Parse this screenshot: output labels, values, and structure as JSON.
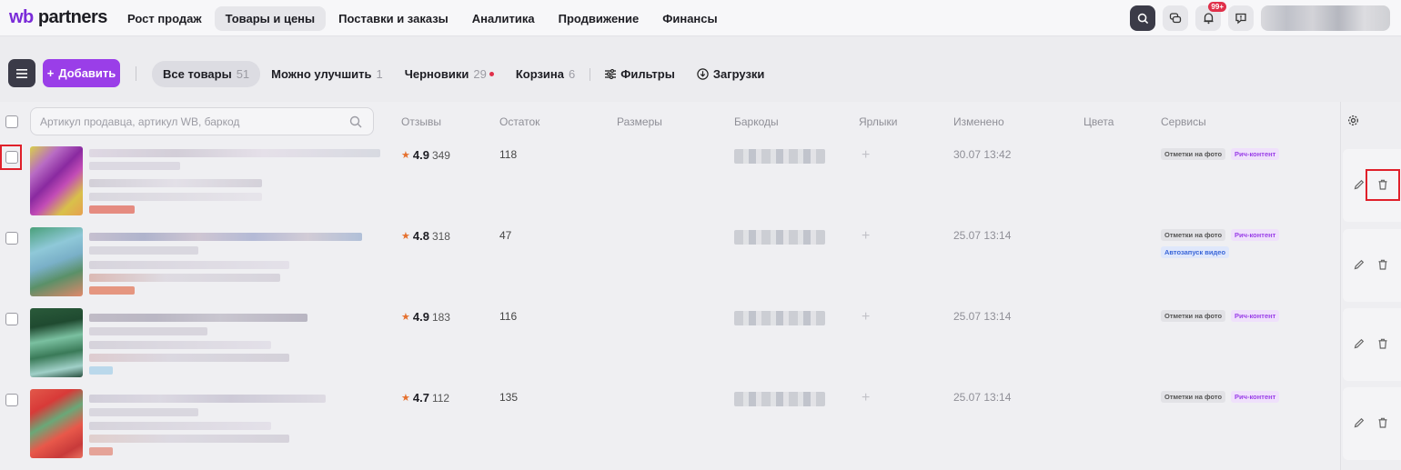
{
  "brand": {
    "logo_prefix": "wb",
    "logo_suffix": " partners"
  },
  "nav": {
    "items": [
      {
        "label": "Рост продаж",
        "active": false
      },
      {
        "label": "Товары и цены",
        "active": true
      },
      {
        "label": "Поставки и заказы",
        "active": false
      },
      {
        "label": "Аналитика",
        "active": false
      },
      {
        "label": "Продвижение",
        "active": false
      },
      {
        "label": "Финансы",
        "active": false
      }
    ],
    "notifications_badge": "99+",
    "icons": [
      "search-icon",
      "chat-icon",
      "bell-icon",
      "support-icon"
    ]
  },
  "toolbar": {
    "add_label": "Добавить",
    "tabs": [
      {
        "label": "Все товары",
        "count": "51",
        "active": true
      },
      {
        "label": "Можно улучшить",
        "count": "1"
      },
      {
        "label": "Черновики",
        "count": "29"
      },
      {
        "label": "Корзина",
        "count": "6"
      }
    ],
    "filters_label": "Фильтры",
    "uploads_label": "Загрузки"
  },
  "table": {
    "search_placeholder": "Артикул продавца, артикул WB, баркод",
    "columns": {
      "reviews": "Отзывы",
      "stock": "Остаток",
      "sizes": "Размеры",
      "barcodes": "Баркоды",
      "labels": "Ярлыки",
      "changed": "Изменено",
      "colors": "Цвета",
      "services": "Сервисы"
    },
    "rows": [
      {
        "rating": "4.9",
        "reviews": "349",
        "stock": "118",
        "changed": "30.07 13:42",
        "services": [
          "Отметки на фото",
          "Рич-контент"
        ]
      },
      {
        "rating": "4.8",
        "reviews": "318",
        "stock": "47",
        "changed": "25.07 13:14",
        "services": [
          "Отметки на фото",
          "Рич-контент",
          "Автозапуск видео"
        ]
      },
      {
        "rating": "4.9",
        "reviews": "183",
        "stock": "116",
        "changed": "25.07 13:14",
        "services": [
          "Отметки на фото",
          "Рич-контент"
        ]
      },
      {
        "rating": "4.7",
        "reviews": "112",
        "stock": "135",
        "changed": "25.07 13:14",
        "services": [
          "Отметки на фото",
          "Рич-контент"
        ]
      }
    ]
  },
  "colors": {
    "accent": "#9a3ee8",
    "dark_button": "#3b3b48",
    "star": "#e5702e",
    "highlight": "#e0202a",
    "badge": "#e0304a"
  }
}
